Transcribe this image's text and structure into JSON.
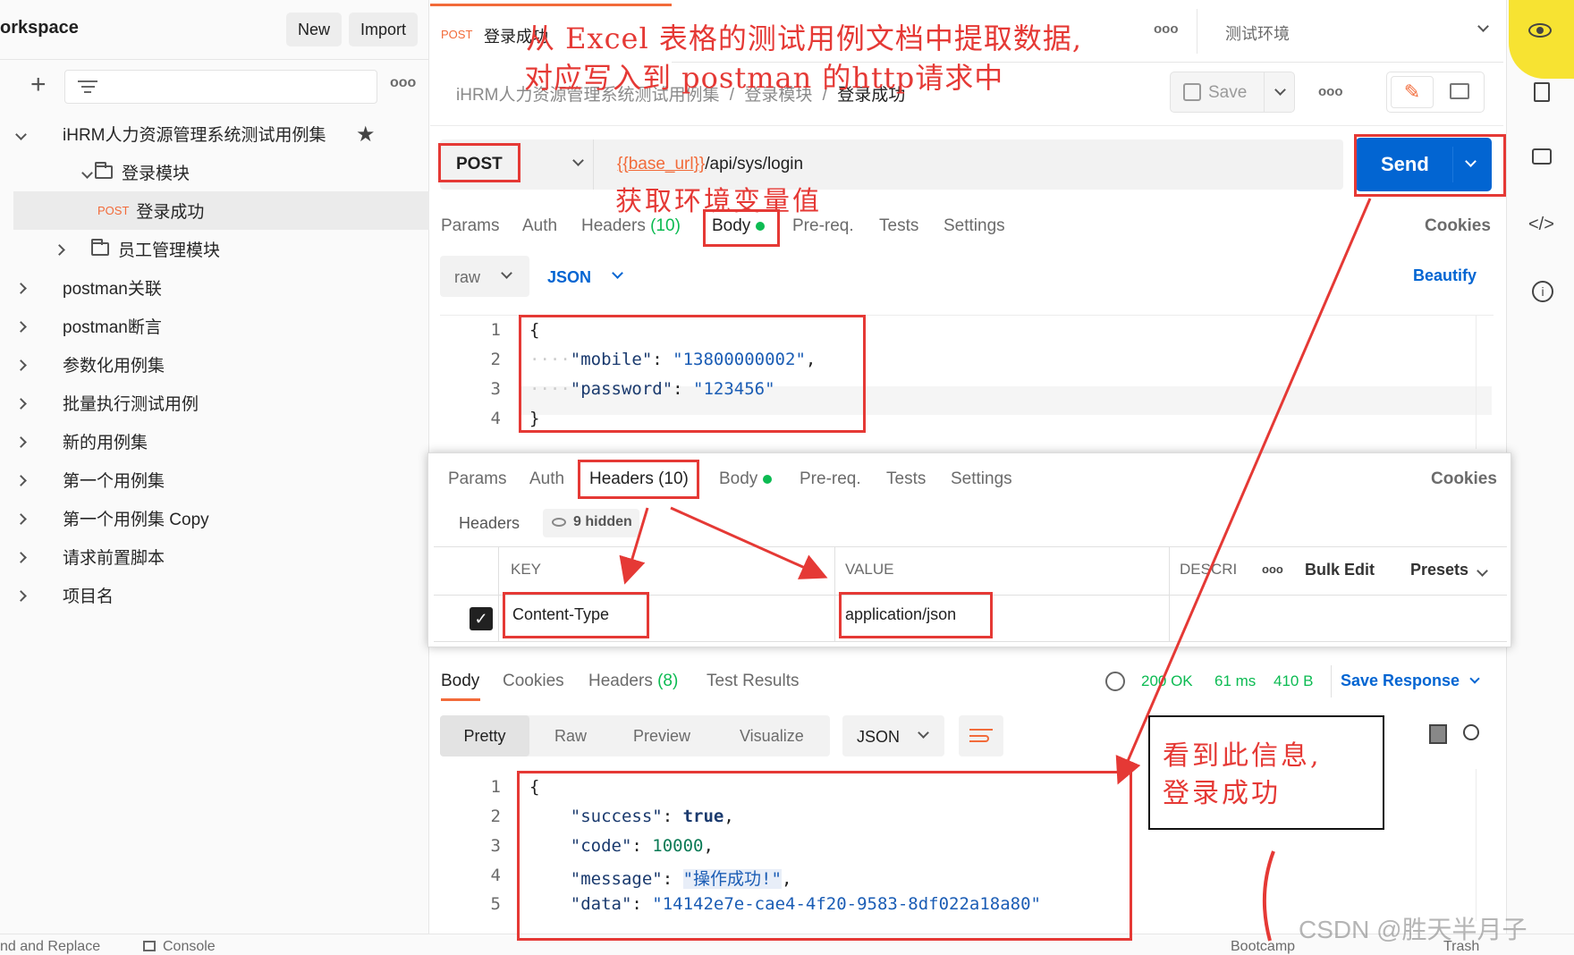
{
  "sidebar": {
    "workspace_title": "orkspace",
    "new_label": "New",
    "import_label": "Import",
    "more": "ooo",
    "items": [
      {
        "label": "iHRM人力资源管理系统测试用例集"
      },
      {
        "label": "登录模块"
      },
      {
        "method": "POST",
        "label": "登录成功"
      },
      {
        "label": "员工管理模块"
      },
      {
        "label": "postman关联"
      },
      {
        "label": "postman断言"
      },
      {
        "label": "参数化用例集"
      },
      {
        "label": "批量执行测试用例"
      },
      {
        "label": "新的用例集"
      },
      {
        "label": "第一个用例集"
      },
      {
        "label": "第一个用例集 Copy"
      },
      {
        "label": "请求前置脚本"
      },
      {
        "label": "项目名"
      }
    ]
  },
  "tabbar": {
    "tab_method": "POST",
    "tab_title": "登录成功",
    "more": "ooo",
    "environment": "测试环境"
  },
  "breadcrumb": {
    "collection": "iHRM人力资源管理系统测试用例集",
    "folder": "登录模块",
    "current": "登录成功",
    "sep": "/"
  },
  "actions": {
    "save": "Save",
    "more": "ooo"
  },
  "request": {
    "method": "POST",
    "url_var": "{{base_url}}",
    "url_path": "/api/sys/login",
    "send": "Send"
  },
  "request_tabs": {
    "params": "Params",
    "auth": "Auth",
    "headers": "Headers",
    "headers_count": "(10)",
    "body": "Body",
    "prereq": "Pre-req.",
    "tests": "Tests",
    "settings": "Settings",
    "cookies": "Cookies"
  },
  "body_opts": {
    "raw": "raw",
    "json": "JSON",
    "beautify": "Beautify"
  },
  "request_body": [
    {
      "n": "1",
      "text": "{"
    },
    {
      "n": "2",
      "key": "\"mobile\"",
      "value": "\"13800000002\"",
      "trail": ","
    },
    {
      "n": "3",
      "key": "\"password\"",
      "value": "\"123456\"",
      "trail": ""
    },
    {
      "n": "4",
      "text": "}"
    }
  ],
  "headers_panel": {
    "tabs": {
      "params": "Params",
      "auth": "Auth",
      "headers": "Headers (10)",
      "body": "Body",
      "prereq": "Pre-req.",
      "tests": "Tests",
      "settings": "Settings",
      "cookies": "Cookies"
    },
    "label": "Headers",
    "hidden": "9 hidden",
    "columns": {
      "key": "KEY",
      "value": "VALUE",
      "desc": "DESCRI",
      "more": "ooo",
      "bulk": "Bulk Edit",
      "presets": "Presets"
    },
    "rows": [
      {
        "key": "Content-Type",
        "value": "application/json"
      }
    ]
  },
  "response": {
    "tabs": {
      "body": "Body",
      "cookies": "Cookies",
      "headers": "Headers",
      "headers_count": "(8)",
      "tests": "Test Results"
    },
    "status": "200 OK",
    "time": "61 ms",
    "size": "410 B",
    "save": "Save Response",
    "views": {
      "pretty": "Pretty",
      "raw": "Raw",
      "preview": "Preview",
      "visualize": "Visualize",
      "format": "JSON"
    },
    "lines": [
      {
        "n": "1",
        "text": "{"
      },
      {
        "n": "2",
        "key": "\"success\"",
        "value": "true",
        "trail": ","
      },
      {
        "n": "3",
        "key": "\"code\"",
        "value": "10000",
        "trail": ","
      },
      {
        "n": "4",
        "key": "\"message\"",
        "value": "\"操作成功!\"",
        "trail": ","
      },
      {
        "n": "5",
        "key": "\"data\"",
        "value": "\"14142e7e-cae4-4f20-9583-8df022a18a80\"",
        "trail": ""
      }
    ]
  },
  "annotations": {
    "top_line1": "从 Excel 表格的测试用例文档中提取数据,",
    "top_line2": "对应写入到 postman 的http请求中",
    "env_var": "获取环境变量值",
    "success_line1": "看到此信息,",
    "success_line2": "登录成功"
  },
  "footer": {
    "find_replace": "nd and Replace",
    "console": "Console",
    "bootcamp": "Bootcamp",
    "trash": "Trash"
  },
  "watermark": "CSDN @胜天半月子",
  "colors": {
    "send": "#0265d2",
    "annotation": "#e53935",
    "accent": "#f26b3a"
  }
}
